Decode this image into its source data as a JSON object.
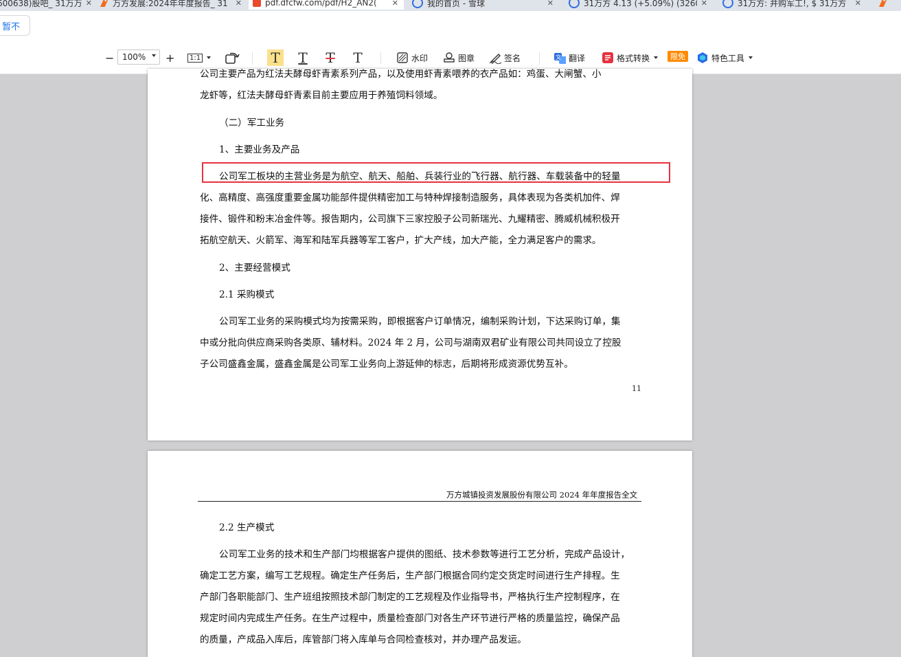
{
  "tabs": [
    {
      "label": "600638)股吧_ 31万万",
      "favicon": "orange"
    },
    {
      "label": "万方发展:2024年年度报告_ 31",
      "favicon": "orange"
    },
    {
      "label": "pdf.dfcfw.com/pdf/H2_AN2(",
      "favicon": "red",
      "active": true
    },
    {
      "label": "我的首页 - 雪球",
      "favicon": "blue"
    },
    {
      "label": "31万方 4.13 (+5.09%) (3260",
      "favicon": "blue"
    },
    {
      "label": "31万方: 并购军工!, $ 31万方",
      "favicon": "blue"
    },
    {
      "label": "",
      "favicon": "orange"
    }
  ],
  "address_row": {
    "pause_label": "暂不"
  },
  "toolbar": {
    "zoom_out": "−",
    "zoom_value": "100%",
    "zoom_in": "+",
    "fit_label": "1:1",
    "watermark": "水印",
    "stamp": "图章",
    "signature": "签名",
    "translate": "翻译",
    "format_convert": "格式转换",
    "free_badge": "限免",
    "special_tools": "特色工具"
  },
  "page1": {
    "lines": [
      "公司主要产品为红法夫酵母虾青素系列产品，以及使用虾青素喂养的衣产品如：鸡蛋、大闸蟹、小",
      "龙虾等，红法夫酵母虾青素目前主要应用于养殖饲料领域。",
      "（二）军工业务",
      "1、主要业务及产品",
      "公司军工板块的主营业务是为航空、航天、船舶、兵装行业的飞行器、航行器、车载装备中的轻量",
      "化、高精度、高强度重要金属功能部件提供精密加工与特种焊接制造服务，具体表现为各类机加件、焊",
      "接件、锻件和粉末冶金件等。报告期内，公司旗下三家控股子公司新瑞光、九耀精密、腾威机械积极开",
      "拓航空航天、火箭军、海军和陆军兵器等军工客户，扩大产线，加大产能，全力满足客户的需求。",
      "2、主要经营模式",
      "2.1 采购模式",
      "公司军工业务的采购模式均为按需采购，即根据客户订单情况，编制采购计划，下达采购订单，集",
      "中或分批向供应商采购各类原、辅材料。2024 年 2 月，公司与湖南双君矿业有限公司共同设立了控股",
      "子公司盛鑫金属，盛鑫金属是公司军工业务向上游延伸的标志，后期将形成资源优势互补。"
    ],
    "page_number": "11"
  },
  "page2": {
    "header": "万方城镇投资发展股份有限公司 2024 年年度报告全文",
    "lines": [
      "2.2 生产模式",
      "公司军工业务的技术和生产部门均根据客户提供的图纸、技术参数等进行工艺分析，完成产品设计，",
      "确定工艺方案，编写工艺规程。确定生产任务后，生产部门根据合同约定交货定时间进行生产排程。生",
      "产部门各职能部门、生产班组按照技术部门制定的工艺规程及作业指导书，严格执行生产控制程序，在",
      "规定时间内完成生产任务。在生产过程中，质量检查部门对各生产环节进行严格的质量监控，确保产品",
      "的质量，产成品入库后，库管部门将入库单与合同检查核对，并办理产品发运。"
    ]
  },
  "colors": {
    "highlight_box": "#e5323e",
    "page_bg": "#cfcfd1",
    "free_badge": "#ff8a00"
  }
}
